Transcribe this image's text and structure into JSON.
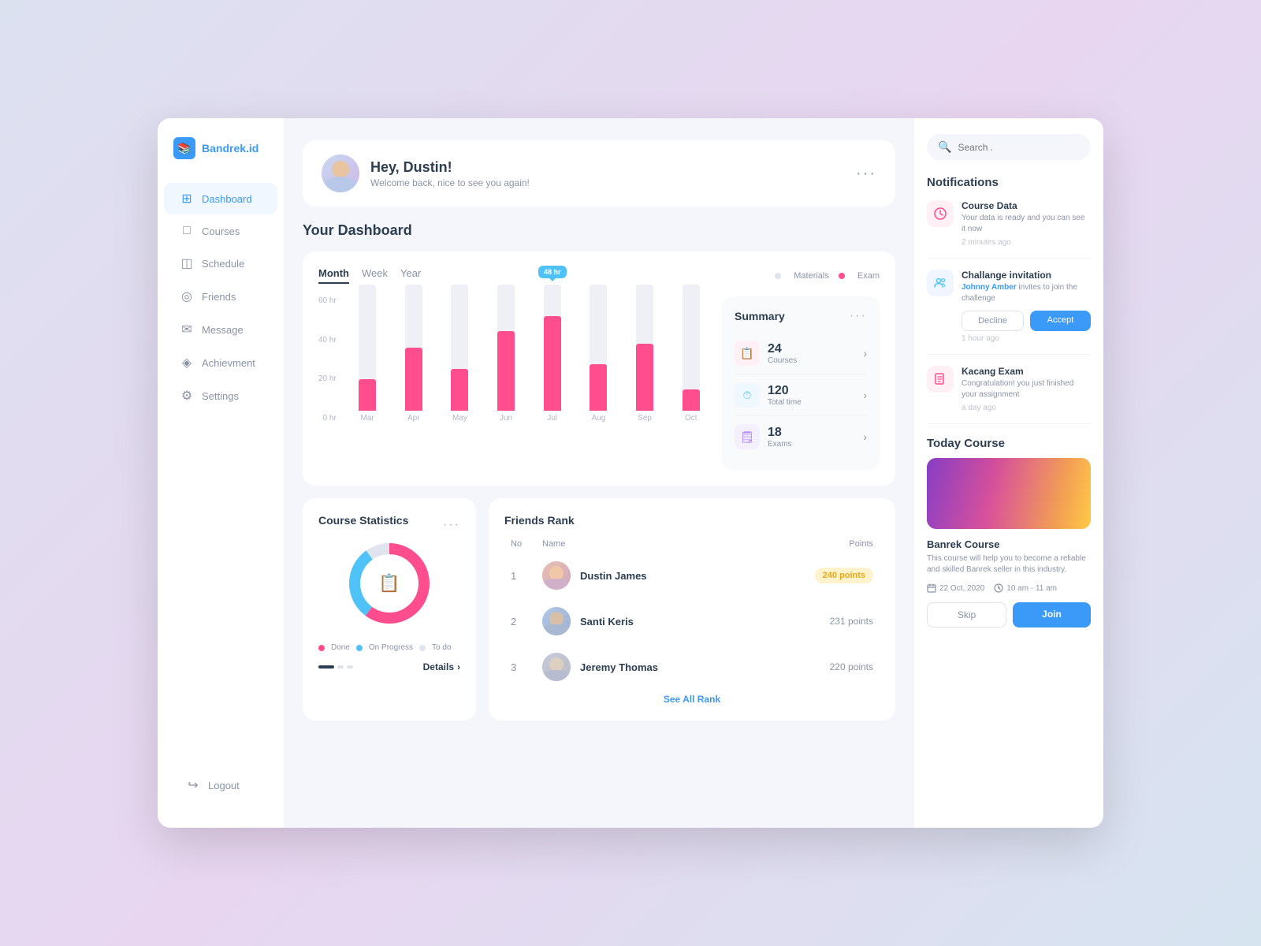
{
  "sidebar": {
    "logo_text": "Bandrek.id",
    "items": [
      {
        "label": "Dashboard",
        "icon": "⊞",
        "active": true
      },
      {
        "label": "Courses",
        "icon": "📄"
      },
      {
        "label": "Schedule",
        "icon": "🗓"
      },
      {
        "label": "Friends",
        "icon": "👥"
      },
      {
        "label": "Message",
        "icon": "✉"
      },
      {
        "label": "Achievment",
        "icon": "⚙"
      },
      {
        "label": "Settings",
        "icon": "⚙"
      }
    ],
    "logout_label": "Logout"
  },
  "header": {
    "greeting": "Hey, Dustin!",
    "subtitle": "Welcome back, nice to see you again!"
  },
  "dashboard": {
    "title": "Your Dashboard",
    "chart": {
      "tabs": [
        "Month",
        "Week",
        "Year"
      ],
      "active_tab": "Month",
      "legend": {
        "materials": "Materials",
        "exam": "Exam"
      },
      "y_labels": [
        "60 hr",
        "40 hr",
        "20 hr",
        "0 hr"
      ],
      "bars": [
        {
          "month": "Mar",
          "total": 60,
          "pink": 15
        },
        {
          "month": "Apr",
          "total": 60,
          "pink": 30
        },
        {
          "month": "May",
          "total": 60,
          "pink": 20
        },
        {
          "month": "Jun",
          "total": 60,
          "pink": 38
        },
        {
          "month": "Jul",
          "total": 60,
          "pink": 45,
          "highlight": "48 hr"
        },
        {
          "month": "Aug",
          "total": 60,
          "pink": 22
        },
        {
          "month": "Sep",
          "total": 60,
          "pink": 32
        },
        {
          "month": "Oct",
          "total": 60,
          "pink": 10
        }
      ]
    },
    "summary": {
      "title": "Summary",
      "items": [
        {
          "num": "24",
          "label": "Courses"
        },
        {
          "num": "120",
          "label": "Total time"
        },
        {
          "num": "18",
          "label": "Exams"
        }
      ]
    }
  },
  "course_statistics": {
    "title": "Course Statistics",
    "legend": [
      {
        "color": "#ff4d8d",
        "label": "Done"
      },
      {
        "color": "#4fc3f7",
        "label": "On Progress"
      },
      {
        "color": "#e0e4ee",
        "label": "To do"
      }
    ],
    "details_label": "Details"
  },
  "friends_rank": {
    "title": "Friends Rank",
    "headers": [
      "No",
      "Name",
      "Points"
    ],
    "rows": [
      {
        "rank": 1,
        "name": "Dustin James",
        "points": "240 points",
        "badge": true,
        "color": "#f0a0a0"
      },
      {
        "rank": 2,
        "name": "Santi Keris",
        "points": "231 points",
        "badge": false,
        "color": "#a0c8f0"
      },
      {
        "rank": 3,
        "name": "Jeremy Thomas",
        "points": "220 points",
        "badge": false,
        "color": "#b0b8d0"
      }
    ],
    "see_all_label": "See All Rank"
  },
  "notifications": {
    "title": "Notifications",
    "search_placeholder": "Search .",
    "items": [
      {
        "title": "Course Data",
        "description": "Your data is ready and you can see it now",
        "time": "2 minutes ago",
        "type": "pink"
      },
      {
        "title": "Challange invitation",
        "description": "inviter: Johnny Amber",
        "desc2": "invites to join the challenge",
        "time": "1 hour ago",
        "type": "blue",
        "has_actions": true
      },
      {
        "title": "Kacang Exam",
        "description": "Congratulation! you just finished your assignment",
        "time": "a day ago",
        "type": "pink"
      }
    ],
    "btn_decline": "Decline",
    "btn_accept": "Accept"
  },
  "today_course": {
    "title": "Today Course",
    "course_name": "Banrek Course",
    "course_desc": "This course will help you to become a reliable and skilled Banrek seller in this industry.",
    "date": "22 Oct, 2020",
    "time": "10 am - 11 am",
    "btn_skip": "Skip",
    "btn_join": "Join"
  }
}
